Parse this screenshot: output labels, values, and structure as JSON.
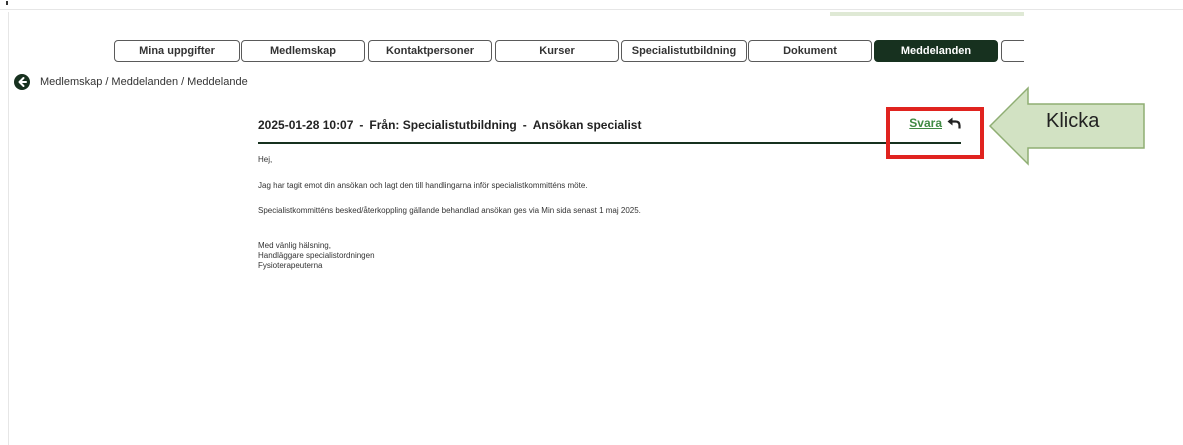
{
  "tabs": [
    {
      "label": "Mina uppgifter",
      "active": false
    },
    {
      "label": "Medlemskap",
      "active": false
    },
    {
      "label": "Kontaktpersoner",
      "active": false
    },
    {
      "label": "Kurser",
      "active": false
    },
    {
      "label": "Specialistutbildning",
      "active": false
    },
    {
      "label": "Dokument",
      "active": false
    },
    {
      "label": "Meddelanden",
      "active": true
    },
    {
      "label": "",
      "active": false
    }
  ],
  "breadcrumb": {
    "items": [
      "Medlemskap",
      "Meddelanden",
      "Meddelande"
    ],
    "separator": "/"
  },
  "message": {
    "datetime": "2025-01-28 10:07",
    "dash": "-",
    "from": "Från: Specialistutbildning",
    "subject": "Ansökan specialist",
    "reply_label": "Svara",
    "greeting": "Hej,",
    "paragraph1": "Jag har tagit emot din ansökan och lagt den till handlingarna inför specialistkommitténs möte.",
    "paragraph2": "Specialistkommitténs besked/återkoppling gällande behandlad ansökan ges via Min sida senast 1 maj 2025.",
    "signoff": "Med vänlig hälsning,",
    "sender_role": "Handläggare specialistordningen",
    "organization": "Fysioterapeuterna"
  },
  "annotation": {
    "callout_text": "Klicka"
  },
  "colors": {
    "accent_dark_green": "#17311f",
    "link_green": "#3f8a43",
    "annotation_red": "#e0231f",
    "callout_fill": "#d2e2c3",
    "callout_border": "#8fae73"
  },
  "icons": {
    "back": "arrow-left-circle-icon",
    "reply": "reply-arrow-icon"
  }
}
